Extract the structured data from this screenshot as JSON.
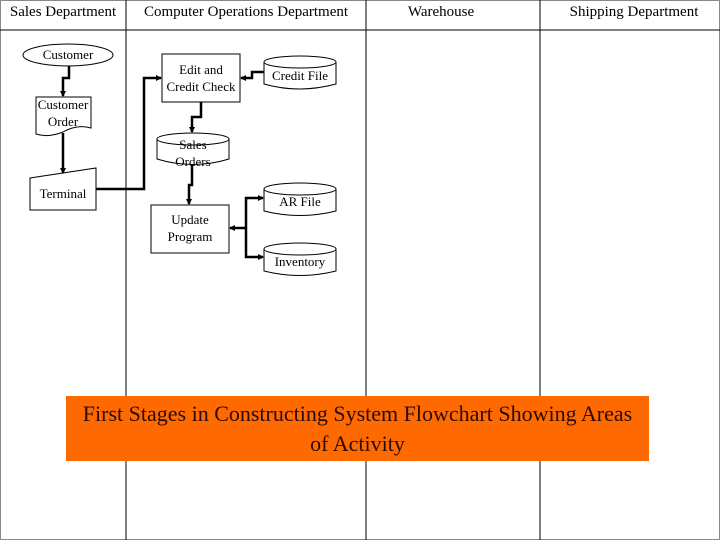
{
  "lanes": [
    {
      "label": "Sales Department"
    },
    {
      "label": "Computer Operations Department"
    },
    {
      "label": "Warehouse"
    },
    {
      "label": "Shipping Department"
    }
  ],
  "nodes": {
    "customer": {
      "label": "Customer",
      "shape": "terminator-oval"
    },
    "customer_order": {
      "line1": "Customer",
      "line2": "Order",
      "shape": "document"
    },
    "terminal": {
      "label": "Terminal",
      "shape": "manual-input"
    },
    "edit_credit": {
      "line1": "Edit and",
      "line2": "Credit Check",
      "shape": "process"
    },
    "credit_file": {
      "label": "Credit File",
      "shape": "disk-storage"
    },
    "sales_orders": {
      "line1": "Sales",
      "line2": "Orders",
      "shape": "disk-storage"
    },
    "update_program": {
      "line1": "Update",
      "line2": "Program",
      "shape": "process"
    },
    "ar_file": {
      "label": "AR File",
      "shape": "disk-storage"
    },
    "inventory": {
      "label": "Inventory",
      "shape": "disk-storage"
    }
  },
  "caption": {
    "text": "First Stages in Constructing System Flowchart Showing Areas of Activity",
    "background": "#ff6a00"
  }
}
